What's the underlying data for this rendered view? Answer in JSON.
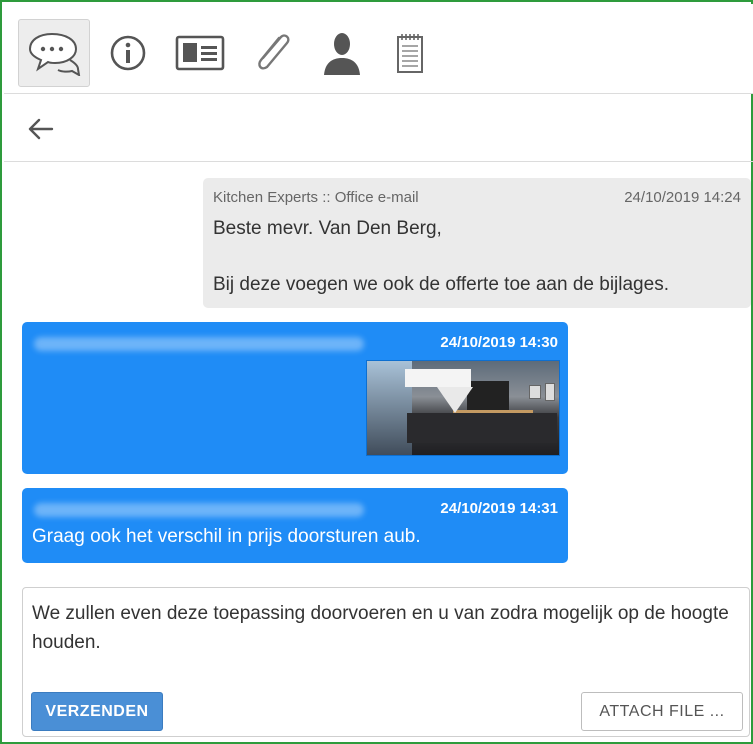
{
  "toolbar": {
    "icons": [
      "chat-icon",
      "info-icon",
      "contact-card-icon",
      "paperclip-icon",
      "person-icon",
      "notepad-icon"
    ],
    "active": "chat-icon"
  },
  "nav": {
    "back_icon": "arrow-left-icon"
  },
  "messages": [
    {
      "direction": "incoming",
      "sender": "Kitchen Experts :: Office e-mail",
      "time": "24/10/2019 14:24",
      "lines": [
        "Beste mevr. Van Den Berg,",
        "Bij deze voegen we ook de offerte toe aan de bijlages."
      ]
    },
    {
      "direction": "outgoing",
      "time": "24/10/2019 14:30",
      "attachment": "kitchen-render-image"
    },
    {
      "direction": "outgoing",
      "time": "24/10/2019 14:31",
      "text": "Graag ook het verschil in prijs doorsturen aub."
    }
  ],
  "compose": {
    "value": "We zullen even deze toepassing doorvoeren en u van zodra mogelijk op de hoogte houden.",
    "send_label": "VERZENDEN",
    "attach_label": "ATTACH FILE ..."
  },
  "colors": {
    "frame_border": "#2e9b3c",
    "outgoing_bubble": "#1f8cf6",
    "incoming_bubble": "#ebebeb",
    "send_button": "#4a8fd6"
  }
}
